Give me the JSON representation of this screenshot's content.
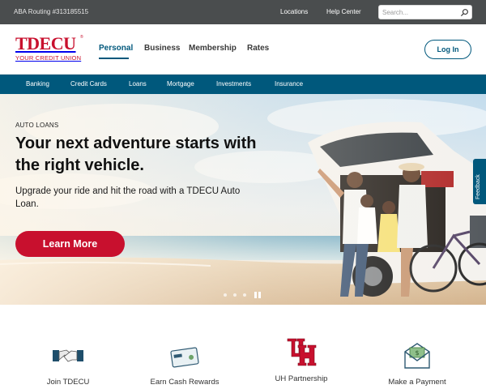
{
  "utility_bar": {
    "routing": "ABA Routing #313185515",
    "links": [
      "Locations",
      "Help Center"
    ],
    "search_placeholder": "Search..."
  },
  "brand": {
    "name": "TDECU",
    "tagline": "YOUR CREDIT UNION"
  },
  "main_nav": {
    "items": [
      "Personal",
      "Business",
      "Membership",
      "Rates"
    ],
    "active": "Personal",
    "login_label": "Log In"
  },
  "sub_nav": {
    "items": [
      "Banking",
      "Credit Cards",
      "Loans",
      "Mortgage",
      "Investments",
      "Insurance"
    ]
  },
  "hero": {
    "eyebrow": "AUTO LOANS",
    "headline": "Your next adventure starts with the right vehicle.",
    "subcopy": "Upgrade your ride and hit the road with a TDECU Auto Loan.",
    "cta_label": "Learn More",
    "slide_count": 3
  },
  "feedback_tab": "Feedback",
  "quick_links": [
    {
      "label": "Join TDECU",
      "icon": "handshake-icon"
    },
    {
      "label": "Earn Cash Rewards",
      "icon": "cash-card-icon"
    },
    {
      "label": "UH Partnership",
      "icon": "uh-logo-icon"
    },
    {
      "label": "Make a Payment",
      "icon": "payment-envelope-icon"
    }
  ],
  "colors": {
    "brand_red": "#c8102e",
    "brand_teal": "#00587c",
    "utility_gray": "#4a4d4e"
  }
}
